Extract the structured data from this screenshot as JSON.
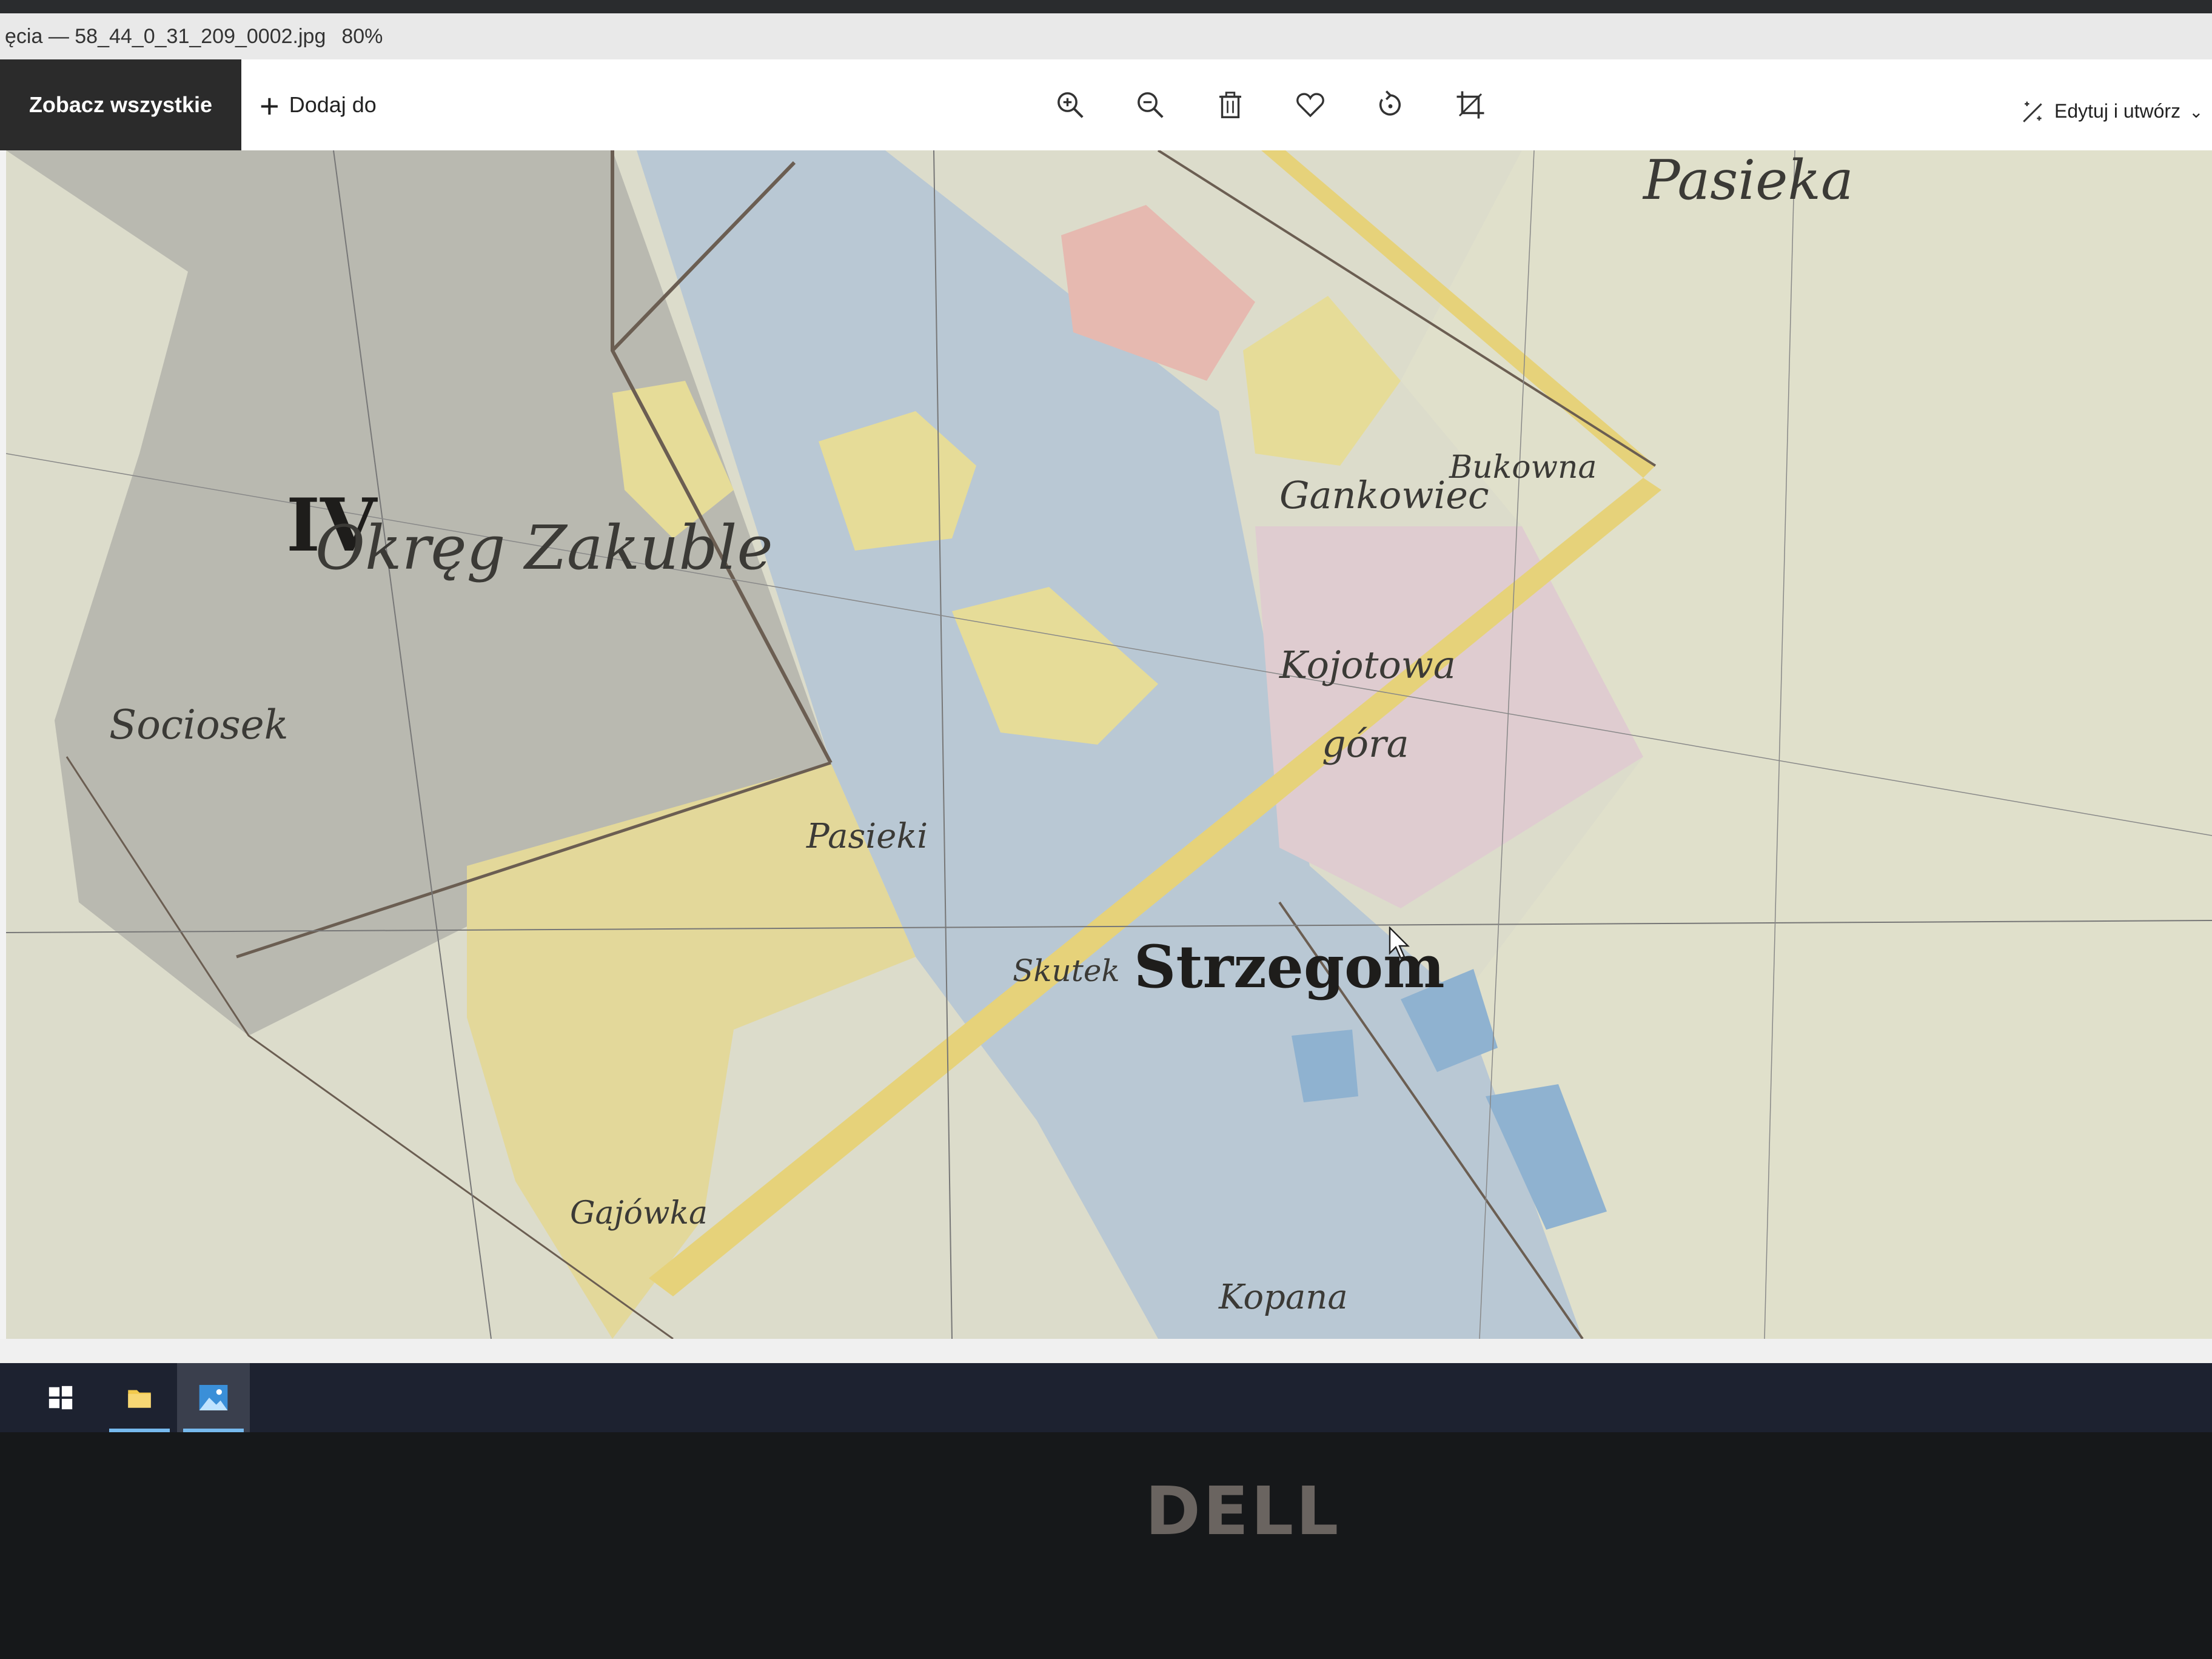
{
  "window": {
    "title": "ęcia — 58_44_0_31_209_0002.jpg",
    "zoom": "80%"
  },
  "toolbar": {
    "see_all_label": "Zobacz wszystkie zdjęcia",
    "add_to_label": "Dodaj do",
    "tools": [
      "zoom-in-icon",
      "zoom-out-icon",
      "delete-icon",
      "favorite-icon",
      "rotate-icon",
      "crop-icon"
    ],
    "edit_label": "Edytuj i utwórz"
  },
  "map": {
    "labels": {
      "district_numeral": "IV",
      "district_name": "Okręg Zakuble",
      "sociosek": "Sociosek",
      "pasieki": "Pasieki",
      "town": "Strzegom",
      "skutek": "Skutek",
      "kojotowa": "Kojotowa",
      "gora": "góra",
      "gankowiec": "Gankowiec",
      "bukowna": "Bukowna",
      "kopana": "Kopana",
      "gajowka": "Gajówka",
      "top_right": "Pasieka"
    }
  },
  "taskbar": {
    "items": [
      "windows-start-icon",
      "file-explorer-icon",
      "photos-app-icon"
    ]
  },
  "hardware": {
    "brand": "DELL"
  }
}
